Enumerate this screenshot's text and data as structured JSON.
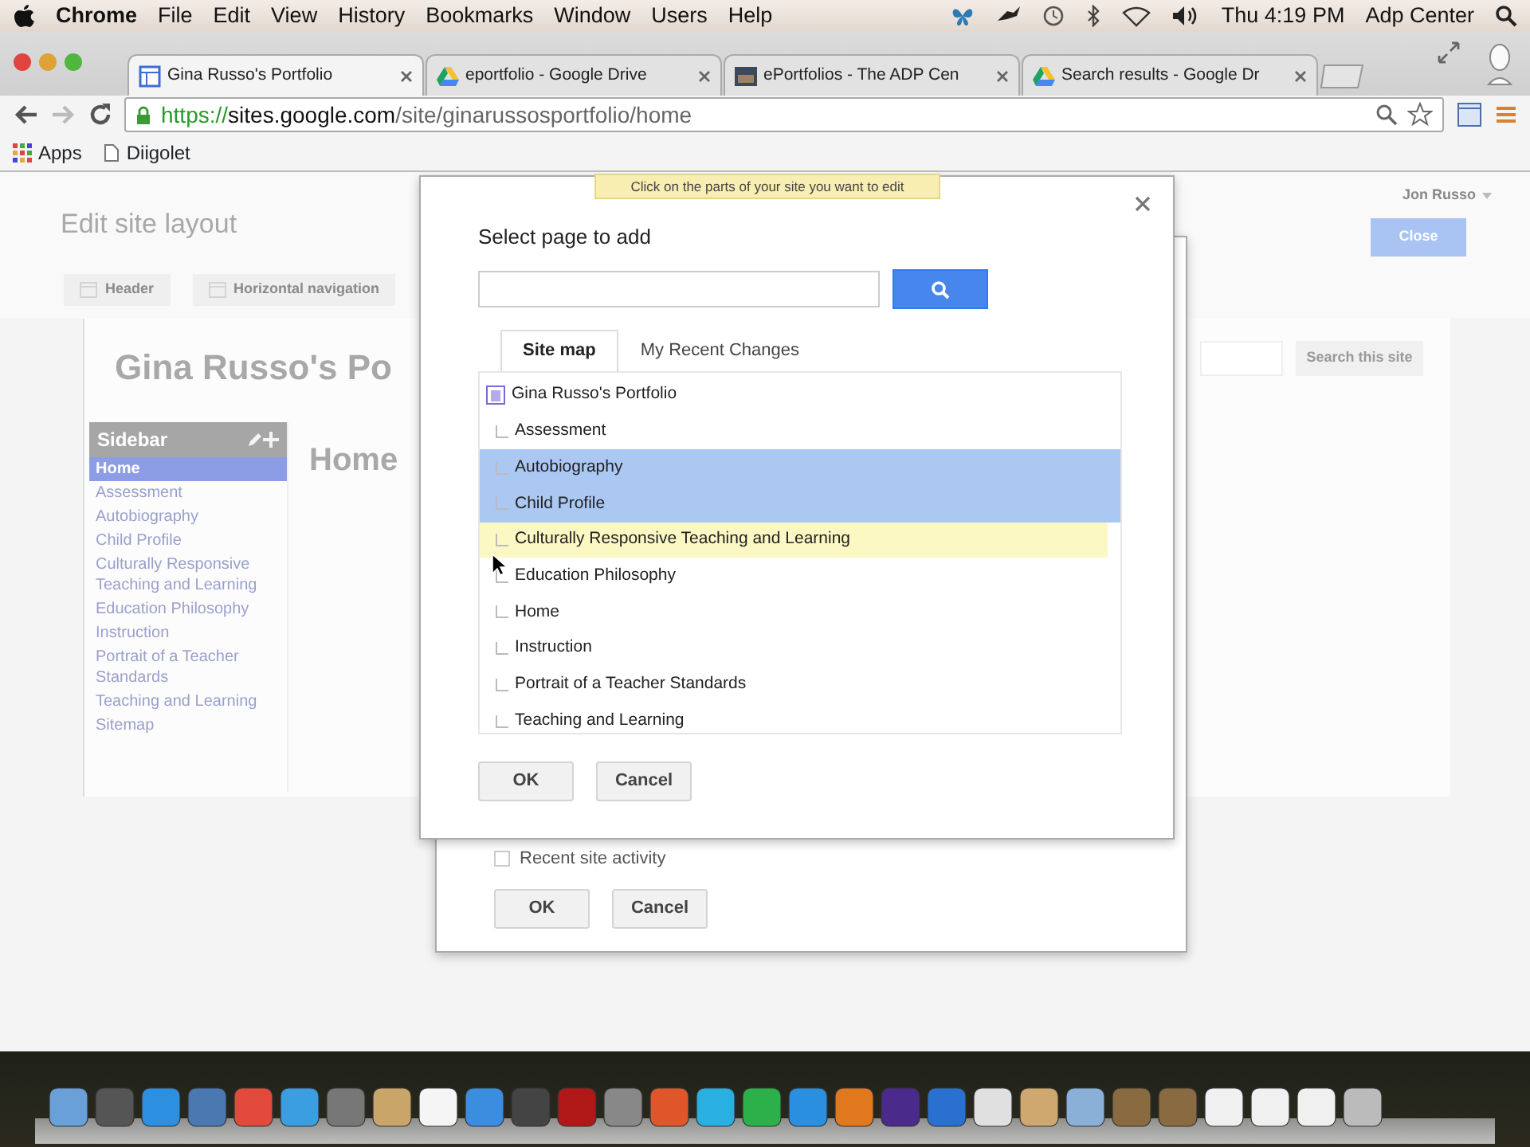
{
  "menu_bar": {
    "app": "Chrome",
    "menus": [
      "File",
      "Edit",
      "View",
      "History",
      "Bookmarks",
      "Window",
      "Users",
      "Help"
    ],
    "clock": "Thu 4:19 PM",
    "user": "Adp Center"
  },
  "browser": {
    "tabs": [
      {
        "title": "Gina Russo's Portfolio",
        "selected": true
      },
      {
        "title": "eportfolio - Google Drive",
        "selected": false
      },
      {
        "title": "ePortfolios - The ADP Cen",
        "selected": false
      },
      {
        "title": "Search results - Google Dr",
        "selected": false
      }
    ],
    "url": {
      "scheme": "https://",
      "host": "sites.google.com",
      "path": "/site/ginarussosportfolio/home"
    },
    "bookmarks": [
      {
        "label": "Apps",
        "kind": "apps"
      },
      {
        "label": "Diigolet",
        "kind": "page"
      }
    ]
  },
  "editor": {
    "title": "Edit site layout",
    "tools": [
      "Header",
      "Horizontal navigation"
    ],
    "user_menu": "Jon Russo",
    "close_button": "Close",
    "hint": "Click on the parts of your site you want to edit",
    "site_title": "Gina Russo's Po",
    "search_button": "Search this site",
    "page_heading": "Home",
    "sidebar": {
      "title": "Sidebar",
      "items": [
        {
          "label": "Home",
          "selected": true
        },
        {
          "label": "Assessment",
          "selected": false
        },
        {
          "label": "Autobiography",
          "selected": false
        },
        {
          "label": "Child Profile",
          "selected": false
        },
        {
          "label": "Culturally Responsive Teaching and Learning",
          "selected": false
        },
        {
          "label": "Education Philosophy",
          "selected": false
        },
        {
          "label": "Instruction",
          "selected": false
        },
        {
          "label": "Portrait of a Teacher Standards",
          "selected": false
        },
        {
          "label": "Teaching and Learning",
          "selected": false
        },
        {
          "label": "Sitemap",
          "selected": false
        }
      ]
    }
  },
  "back_dialog": {
    "checkbox": {
      "label": "Recent site activity",
      "checked": false
    },
    "buttons": [
      "OK",
      "Cancel"
    ]
  },
  "dialog": {
    "title": "Select page to add",
    "tabs": [
      {
        "label": "Site map",
        "selected": true
      },
      {
        "label": "My Recent Changes",
        "selected": false
      }
    ],
    "tree": {
      "label": "Gina Russo's Portfolio",
      "children": [
        {
          "label": "Assessment",
          "selected": false,
          "hovered": false
        },
        {
          "label": "Autobiography",
          "selected": true,
          "hovered": false
        },
        {
          "label": "Child Profile",
          "selected": true,
          "hovered": false
        },
        {
          "label": "Culturally Responsive Teaching and Learning",
          "selected": false,
          "hovered": true
        },
        {
          "label": "Education Philosophy",
          "selected": false,
          "hovered": false
        },
        {
          "label": "Home",
          "selected": false,
          "hovered": false
        },
        {
          "label": "Instruction",
          "selected": false,
          "hovered": false
        },
        {
          "label": "Portrait of a Teacher Standards",
          "selected": false,
          "hovered": false
        },
        {
          "label": "Teaching and Learning",
          "selected": false,
          "hovered": false
        }
      ]
    },
    "buttons": [
      "OK",
      "Cancel"
    ]
  }
}
